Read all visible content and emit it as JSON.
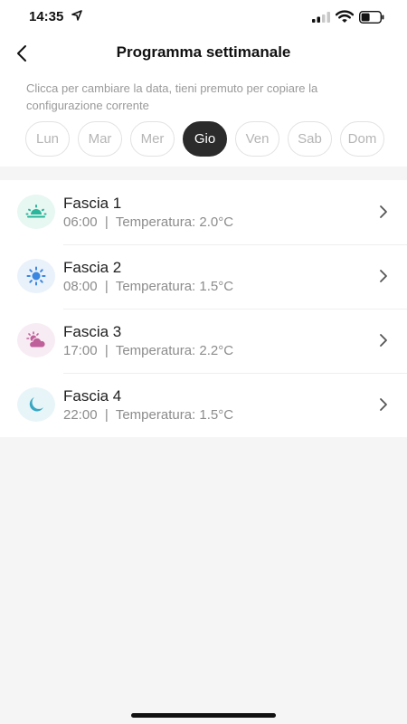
{
  "status": {
    "time": "14:35"
  },
  "header": {
    "title": "Programma settimanale"
  },
  "hint": "Clicca per cambiare la data, tieni premuto per copiare la configurazione corrente",
  "days": [
    {
      "label": "Lun",
      "active": false
    },
    {
      "label": "Mar",
      "active": false
    },
    {
      "label": "Mer",
      "active": false
    },
    {
      "label": "Gio",
      "active": true
    },
    {
      "label": "Ven",
      "active": false
    },
    {
      "label": "Sab",
      "active": false
    },
    {
      "label": "Dom",
      "active": false
    }
  ],
  "slots": [
    {
      "title": "Fascia 1",
      "subtitle": "06:00  |  Temperatura: 2.0°C",
      "icon": "sunrise-icon",
      "icon_color": "#2bb59a",
      "icon_bg": "#e7f7f2"
    },
    {
      "title": "Fascia 2",
      "subtitle": "08:00  |  Temperatura: 1.5°C",
      "icon": "sun-icon",
      "icon_color": "#3a86e0",
      "icon_bg": "#e9f1fb"
    },
    {
      "title": "Fascia 3",
      "subtitle": "17:00  |  Temperatura: 2.2°C",
      "icon": "cloud-sun-icon",
      "icon_color": "#c0609a",
      "icon_bg": "#f7ecf3"
    },
    {
      "title": "Fascia 4",
      "subtitle": "22:00  |  Temperatura: 1.5°C",
      "icon": "moon-icon",
      "icon_color": "#3aa7c2",
      "icon_bg": "#e8f5f8"
    }
  ],
  "colors": {
    "active_day_bg": "#2b2b2b",
    "page_bg": "#f5f5f5"
  }
}
